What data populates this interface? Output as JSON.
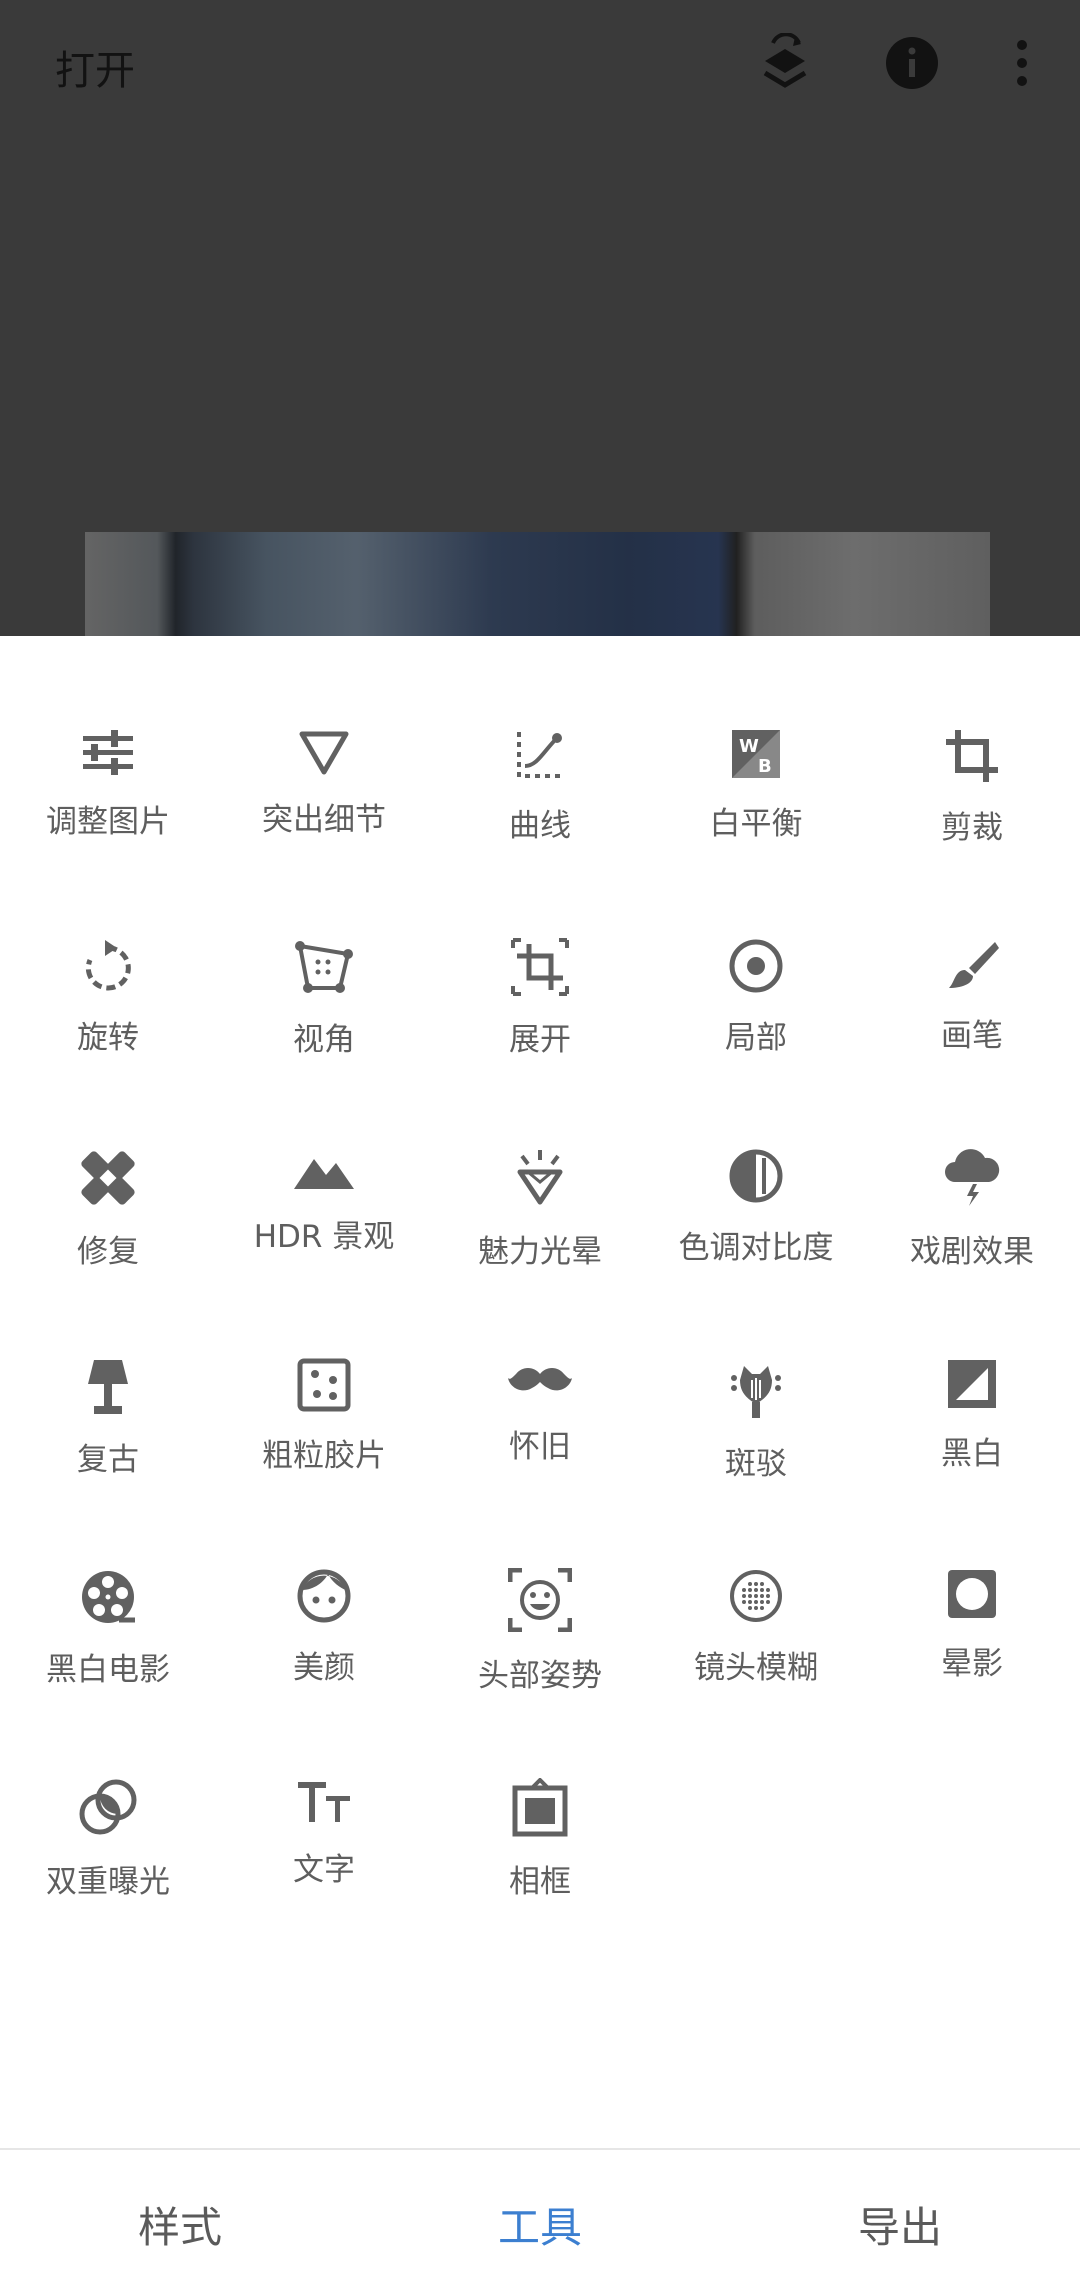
{
  "header": {
    "open_label": "打开"
  },
  "tools": [
    {
      "label": "调整图片",
      "icon": "tune-icon"
    },
    {
      "label": "突出细节",
      "icon": "triangle-icon"
    },
    {
      "label": "曲线",
      "icon": "curves-icon"
    },
    {
      "label": "白平衡",
      "icon": "white-balance-icon"
    },
    {
      "label": "剪裁",
      "icon": "crop-icon"
    },
    {
      "label": "旋转",
      "icon": "rotate-icon"
    },
    {
      "label": "视角",
      "icon": "perspective-icon"
    },
    {
      "label": "展开",
      "icon": "expand-icon"
    },
    {
      "label": "局部",
      "icon": "selective-icon"
    },
    {
      "label": "画笔",
      "icon": "brush-icon"
    },
    {
      "label": "修复",
      "icon": "healing-icon"
    },
    {
      "label": "HDR 景观",
      "icon": "mountain-icon"
    },
    {
      "label": "魅力光晕",
      "icon": "glamour-glow-icon"
    },
    {
      "label": "色调对比度",
      "icon": "tonal-contrast-icon"
    },
    {
      "label": "戏剧效果",
      "icon": "drama-cloud-icon"
    },
    {
      "label": "复古",
      "icon": "lamp-icon"
    },
    {
      "label": "粗粒胶片",
      "icon": "grainy-film-icon"
    },
    {
      "label": "怀旧",
      "icon": "mustache-icon"
    },
    {
      "label": "斑驳",
      "icon": "grunge-guitar-icon"
    },
    {
      "label": "黑白",
      "icon": "black-white-icon"
    },
    {
      "label": "黑白电影",
      "icon": "film-reel-icon"
    },
    {
      "label": "美颜",
      "icon": "face-icon"
    },
    {
      "label": "头部姿势",
      "icon": "head-pose-icon"
    },
    {
      "label": "镜头模糊",
      "icon": "lens-blur-icon"
    },
    {
      "label": "晕影",
      "icon": "vignette-icon"
    },
    {
      "label": "双重曝光",
      "icon": "double-exposure-icon"
    },
    {
      "label": "文字",
      "icon": "text-icon"
    },
    {
      "label": "相框",
      "icon": "frame-icon"
    }
  ],
  "nav": {
    "styles": "样式",
    "tools": "工具",
    "export": "导出"
  },
  "colors": {
    "accent": "#3c7fd0",
    "icon": "#616161",
    "label": "#5e5e5e",
    "dim_overlay": "#3a3a3a"
  }
}
